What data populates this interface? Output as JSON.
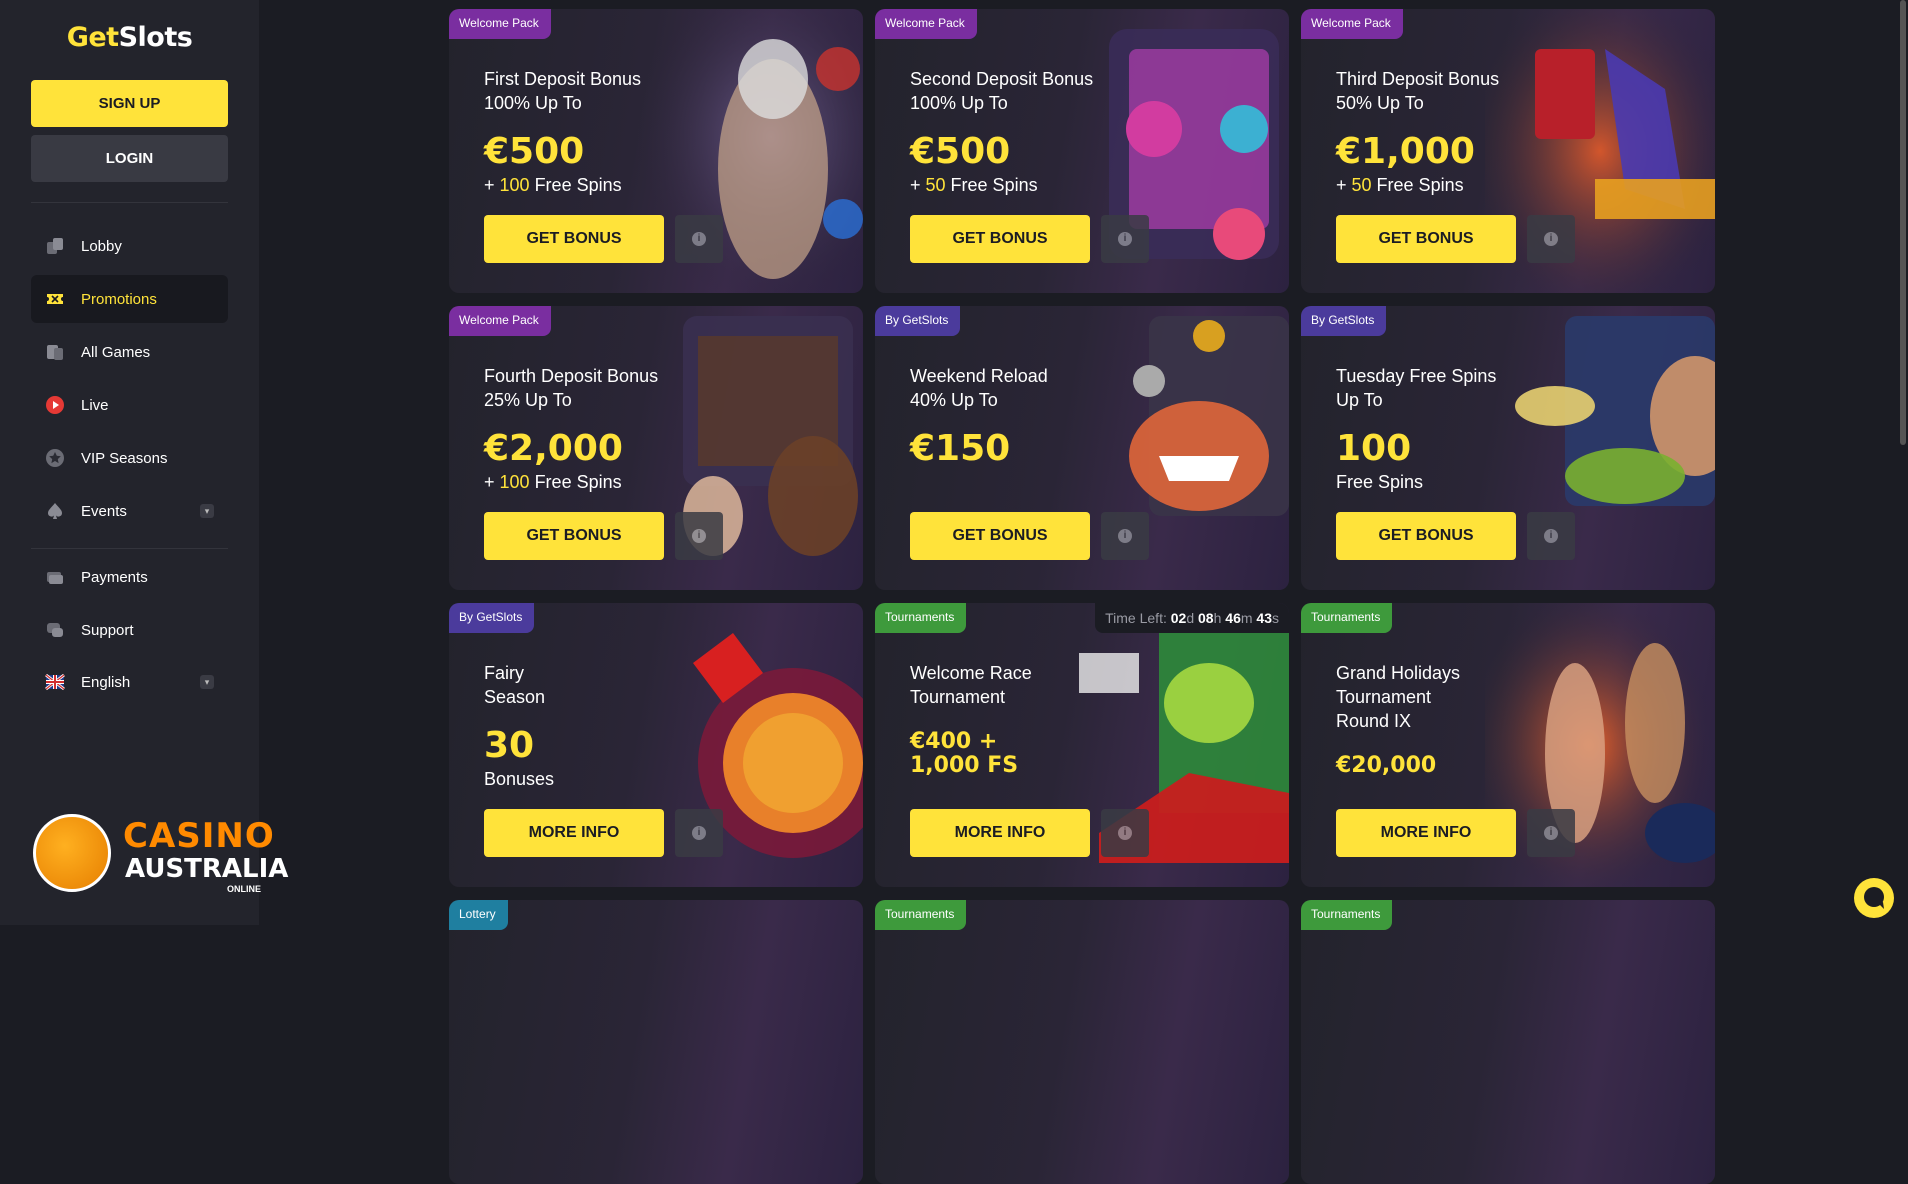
{
  "sidebar": {
    "logo_get": "Get",
    "logo_slots": "Slots",
    "signup_label": "SIGN UP",
    "login_label": "LOGIN",
    "items": [
      {
        "label": "Lobby",
        "icon": "lobby-icon"
      },
      {
        "label": "Promotions",
        "icon": "ticket-icon",
        "active": true
      },
      {
        "label": "All Games",
        "icon": "cards-icon"
      },
      {
        "label": "Live",
        "icon": "live-icon"
      },
      {
        "label": "VIP Seasons",
        "icon": "star-icon"
      },
      {
        "label": "Events",
        "icon": "spade-icon",
        "chevron": true
      },
      {
        "label": "Payments",
        "icon": "payments-icon"
      },
      {
        "label": "Support",
        "icon": "support-icon"
      },
      {
        "label": "English",
        "icon": "uk-flag-icon",
        "chevron": true
      }
    ]
  },
  "watermark": {
    "line1": "CASINO",
    "line2": "AUSTRALIA",
    "line3": "ONLINE"
  },
  "cards": [
    {
      "tag": "Welcome Pack",
      "title": "First Deposit Bonus\n100% Up To",
      "amount": "€500",
      "sub_prefix": "+ ",
      "sub_hl": "100",
      "sub_suffix": " Free Spins",
      "button": "GET BONUS"
    },
    {
      "tag": "Welcome Pack",
      "title": "Second Deposit Bonus\n100% Up To",
      "amount": "€500",
      "sub_prefix": "+ ",
      "sub_hl": "50",
      "sub_suffix": " Free Spins",
      "button": "GET BONUS"
    },
    {
      "tag": "Welcome Pack",
      "title": "Third Deposit Bonus\n50% Up To",
      "amount": "€1,000",
      "sub_prefix": "+ ",
      "sub_hl": "50",
      "sub_suffix": " Free Spins",
      "button": "GET BONUS"
    },
    {
      "tag": "Welcome Pack",
      "title": "Fourth Deposit Bonus\n25% Up To",
      "amount": "€2,000",
      "sub_prefix": "+ ",
      "sub_hl": "100",
      "sub_suffix": " Free Spins",
      "button": "GET BONUS"
    },
    {
      "tag": "By GetSlots",
      "title": "Weekend Reload\n40% Up To",
      "amount": "€150",
      "button": "GET BONUS"
    },
    {
      "tag": "By GetSlots",
      "title": "Tuesday Free Spins\nUp To",
      "amount": "100",
      "sub_suffix": "Free Spins",
      "button": "GET BONUS"
    },
    {
      "tag": "By GetSlots",
      "title": "Fairy\nSeason",
      "amount": "30",
      "sub_suffix": "Bonuses",
      "button": "MORE INFO"
    },
    {
      "tag": "Tournaments",
      "title": "Welcome Race\nTournament",
      "amount": "€400 +\n1,000 FS",
      "button": "MORE INFO",
      "timer": {
        "label": "Time Left:",
        "d": "02",
        "h": "08",
        "m": "46",
        "s": "43"
      }
    },
    {
      "tag": "Tournaments",
      "title": "Grand Holidays\nTournament\nRound IX",
      "amount": "€20,000",
      "button": "MORE INFO"
    },
    {
      "tag": "Lottery"
    },
    {
      "tag": "Tournaments"
    },
    {
      "tag": "Tournaments"
    }
  ],
  "colors": {
    "accent": "#ffe33a",
    "welcome": "#7a2ea0",
    "by": "#4b3b9c",
    "tournament": "#3e9a3c",
    "lottery": "#1f7fa0"
  }
}
